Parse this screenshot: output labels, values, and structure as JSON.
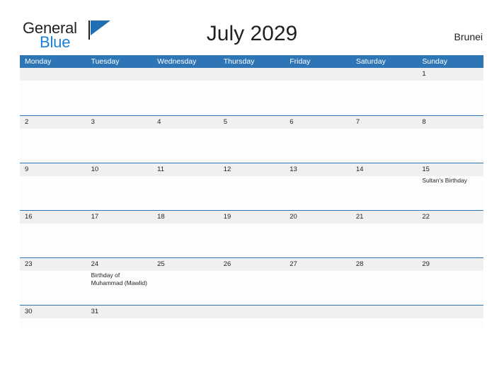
{
  "brand": {
    "word_one": "General",
    "word_two": "Blue",
    "flag_icon": "blue-triangle-flag-icon",
    "accent_color": "#1b7fd4"
  },
  "header": {
    "title": "July 2029",
    "locale": "Brunei"
  },
  "theme": {
    "header_blue": "#2e75b6",
    "date_band_gray": "#f0f0f0",
    "cell_white": "#fdfdfd",
    "text_dark": "#231f20"
  },
  "calendar": {
    "month": "July",
    "year": "2029",
    "weekdays": [
      "Monday",
      "Tuesday",
      "Wednesday",
      "Thursday",
      "Friday",
      "Saturday",
      "Sunday"
    ],
    "weeks": [
      {
        "days": [
          {
            "date": "",
            "events": []
          },
          {
            "date": "",
            "events": []
          },
          {
            "date": "",
            "events": []
          },
          {
            "date": "",
            "events": []
          },
          {
            "date": "",
            "events": []
          },
          {
            "date": "",
            "events": []
          },
          {
            "date": "1",
            "events": []
          }
        ]
      },
      {
        "days": [
          {
            "date": "2",
            "events": []
          },
          {
            "date": "3",
            "events": []
          },
          {
            "date": "4",
            "events": []
          },
          {
            "date": "5",
            "events": []
          },
          {
            "date": "6",
            "events": []
          },
          {
            "date": "7",
            "events": []
          },
          {
            "date": "8",
            "events": []
          }
        ]
      },
      {
        "days": [
          {
            "date": "9",
            "events": []
          },
          {
            "date": "10",
            "events": []
          },
          {
            "date": "11",
            "events": []
          },
          {
            "date": "12",
            "events": []
          },
          {
            "date": "13",
            "events": []
          },
          {
            "date": "14",
            "events": []
          },
          {
            "date": "15",
            "events": [
              "Sultan's Birthday"
            ]
          }
        ]
      },
      {
        "days": [
          {
            "date": "16",
            "events": []
          },
          {
            "date": "17",
            "events": []
          },
          {
            "date": "18",
            "events": []
          },
          {
            "date": "19",
            "events": []
          },
          {
            "date": "20",
            "events": []
          },
          {
            "date": "21",
            "events": []
          },
          {
            "date": "22",
            "events": []
          }
        ]
      },
      {
        "days": [
          {
            "date": "23",
            "events": []
          },
          {
            "date": "24",
            "events": [
              "Birthday of Muhammad (Mawlid)"
            ]
          },
          {
            "date": "25",
            "events": []
          },
          {
            "date": "26",
            "events": []
          },
          {
            "date": "27",
            "events": []
          },
          {
            "date": "28",
            "events": []
          },
          {
            "date": "29",
            "events": []
          }
        ]
      },
      {
        "days": [
          {
            "date": "30",
            "events": []
          },
          {
            "date": "31",
            "events": []
          },
          {
            "date": "",
            "events": []
          },
          {
            "date": "",
            "events": []
          },
          {
            "date": "",
            "events": []
          },
          {
            "date": "",
            "events": []
          },
          {
            "date": "",
            "events": []
          }
        ]
      }
    ]
  }
}
